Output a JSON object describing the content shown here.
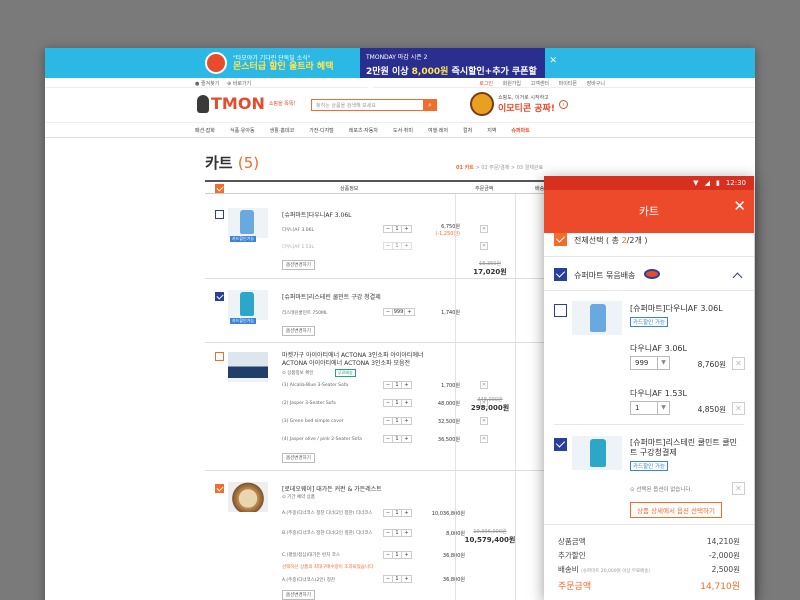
{
  "banner": {
    "line1": "\"타모야가 기다린 단독딜 소식\"",
    "highlight": "몬스터급 할인 울트라 혜택",
    "event_small": "TMONDAY 마감 시즌 2",
    "event_big_a": "2만원 이상 ",
    "event_big_b": "8,000원",
    "event_big_c": " 즉시할인+추가 쿠폰할인",
    "close": "✕"
  },
  "util": {
    "left": [
      "● 즐겨찾기",
      "⊕ 바로가기"
    ],
    "right": [
      "로그인",
      "회원가입",
      "고객센터",
      "마이티몬",
      "장바구니"
    ]
  },
  "header": {
    "logo": "TMON",
    "logo_sub": "쇼핑을\n똑똑!",
    "search_placeholder": "찾히는 상품을 검색해 보세요",
    "search_icon": "⌕",
    "promo_small": "쇼핑도, 이거로 시작하고",
    "promo_big": "이모티콘 공짜!",
    "promo_arrow": "›"
  },
  "nav": [
    "패션·잡화",
    "식품·유아동",
    "생활·홈데코",
    "가전·디지털",
    "레포츠·자동차",
    "도서·취미",
    "여행·레저",
    "컬처",
    "지역",
    "슈퍼마트"
  ],
  "cart": {
    "title": "카트",
    "count": "(5)",
    "steps": [
      "01 카트",
      "02 주문/결제",
      "03 결제완료"
    ],
    "headers": [
      "상품정보",
      "주문금액",
      "배송"
    ]
  },
  "desktop_items": {
    "item1": {
      "title": "[슈퍼마트]다우니AF 3.06L",
      "tag": "카드할인가능",
      "opt1": "다우니AF 3.06L",
      "opt1_qty": "1",
      "opt1_price": "6,750원",
      "opt1_sale": "(-1,250원)",
      "opt2": "다우니AF 1.53L",
      "opt2_qty": "1",
      "btn": "옵션변경하기"
    },
    "item2": {
      "title": "[슈퍼마트]리스테린 쿨민트 구강 청결제",
      "tag": "카드할인가능",
      "opt1": "리스테린쿨민트 750ML",
      "opt1_qty": "999",
      "opt1_price": "1,740원",
      "btn": "옵션변경하기"
    },
    "price12_orig": "18,350원",
    "price12_final": "17,020원",
    "item3": {
      "title": "마켓가구 아이아티에너 ACTONA 3인소파 아이아티에너 ACTONA 아이아티에너 ACTONA 3인소파 모음전",
      "sub": "⊙ 상품정보 확인",
      "badge": "무료배송",
      "opts": [
        {
          "name": "(1) Alcalia-Blue 3-Seater Sofa",
          "qty": "1",
          "price": "1,700원"
        },
        {
          "name": "(2) Jasper 3-Seater Sofa",
          "qty": "1",
          "price": "48,000원"
        },
        {
          "name": "(3) Green bed simple cover",
          "qty": "1",
          "price": "32,500원"
        },
        {
          "name": "(4) Jasper olive / pink 2-Seater Sofa",
          "qty": "1",
          "price": "36,500원"
        }
      ],
      "btn": "옵션변경하기",
      "orig": "348,000원",
      "final": "298,000원"
    },
    "item4": {
      "title": "[로데오웨이] 대가든 커런 & 가든레스트",
      "sub": "⊙ 기간 예약 상품",
      "opts": [
        {
          "name": "A.(주중)디너코스 정찬 디너(2인 정찬) 디너코스",
          "qty": "1",
          "price": "10,036,800원"
        },
        {
          "name": "B.(주중)디너코스 정찬 디너(2인 정찬) 디너코스",
          "qty": "1",
          "price": "8,000원"
        },
        {
          "name": "C.(평일/점심)대가든 런치 코스",
          "qty": "1",
          "price": "36,800원"
        },
        {
          "name": "A.(주중)디너코스(2인) 정찬",
          "qty": "1",
          "price": "36,800원"
        }
      ],
      "warn": "선택하신 상품의 최대구매수량이 초과되었습니다.",
      "btn": "옵션변경하기",
      "orig": "10,996,000원",
      "final": "10,579,400원"
    }
  },
  "mobile": {
    "time": "12:30",
    "title": "카트",
    "close": "✕",
    "select_all_a": "전체선택 ( 총 ",
    "select_all_b": "2",
    "select_all_c": "/2개 )",
    "group": "슈퍼마트 묶음배송",
    "item1_title": "[슈퍼마트]다우니AF 3.06L",
    "item1_tag": "카드할인 가능",
    "item1_opt1": "다우니AF 3.06L",
    "item1_opt1_qty": "999",
    "item1_opt1_price": "8,760원",
    "item1_opt2": "다우니AF 1.53L",
    "item1_opt2_qty": "1",
    "item1_opt2_price": "4,850원",
    "item2_title": "[슈퍼마트]리스테린 쿨민트 쿨민트 구강청결제",
    "item2_tag": "카드할인 가능",
    "item2_note": "⊙ 선택된 옵션이 없습니다.",
    "item2_btn": "상품 상세에서 옵션 선택하기",
    "summary": {
      "goods_label": "상품금액",
      "goods_value": "14,210원",
      "discount_label": "추가할인",
      "discount_value": "-2,000원",
      "ship_label": "배송비",
      "ship_note": "(슈퍼마트 20,000원 이상 무료배송)",
      "ship_value": "2,500원",
      "total_label": "주문금액",
      "total_value": "14,710원"
    }
  },
  "colors": {
    "accent": "#f26c2b",
    "header_red": "#ec4a2b",
    "check_blue": "#2a3f9a",
    "banner_blue": "#2bb8e5"
  }
}
